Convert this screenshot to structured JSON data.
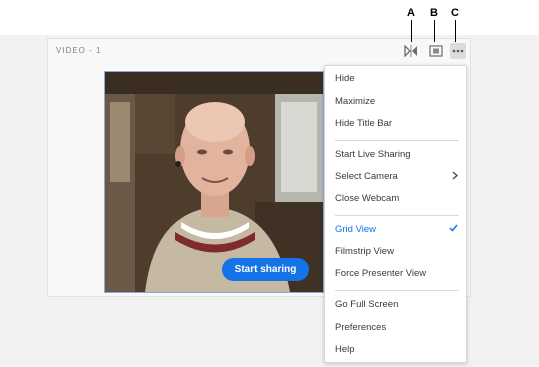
{
  "callouts": [
    "A",
    "B",
    "C"
  ],
  "pod": {
    "title": "VIDEO  - 1",
    "start_sharing_label": "Start sharing"
  },
  "controls": {
    "mirror_icon": "mirror-icon",
    "fullscreen_icon": "fit-screen-icon",
    "more_icon": "more-options-icon"
  },
  "menu": {
    "groups": [
      [
        "Hide",
        "Maximize",
        "Hide Title Bar"
      ],
      [
        "Start Live Sharing",
        "Select Camera",
        "Close Webcam"
      ],
      [
        "Grid View",
        "Filmstrip View",
        "Force Presenter View"
      ],
      [
        "Go Full Screen",
        "Preferences",
        "Help"
      ]
    ],
    "submenu_item": "Select Camera",
    "checked_item": "Grid View",
    "check_color": "#1473e6"
  },
  "colors": {
    "accent": "#1473e6"
  }
}
